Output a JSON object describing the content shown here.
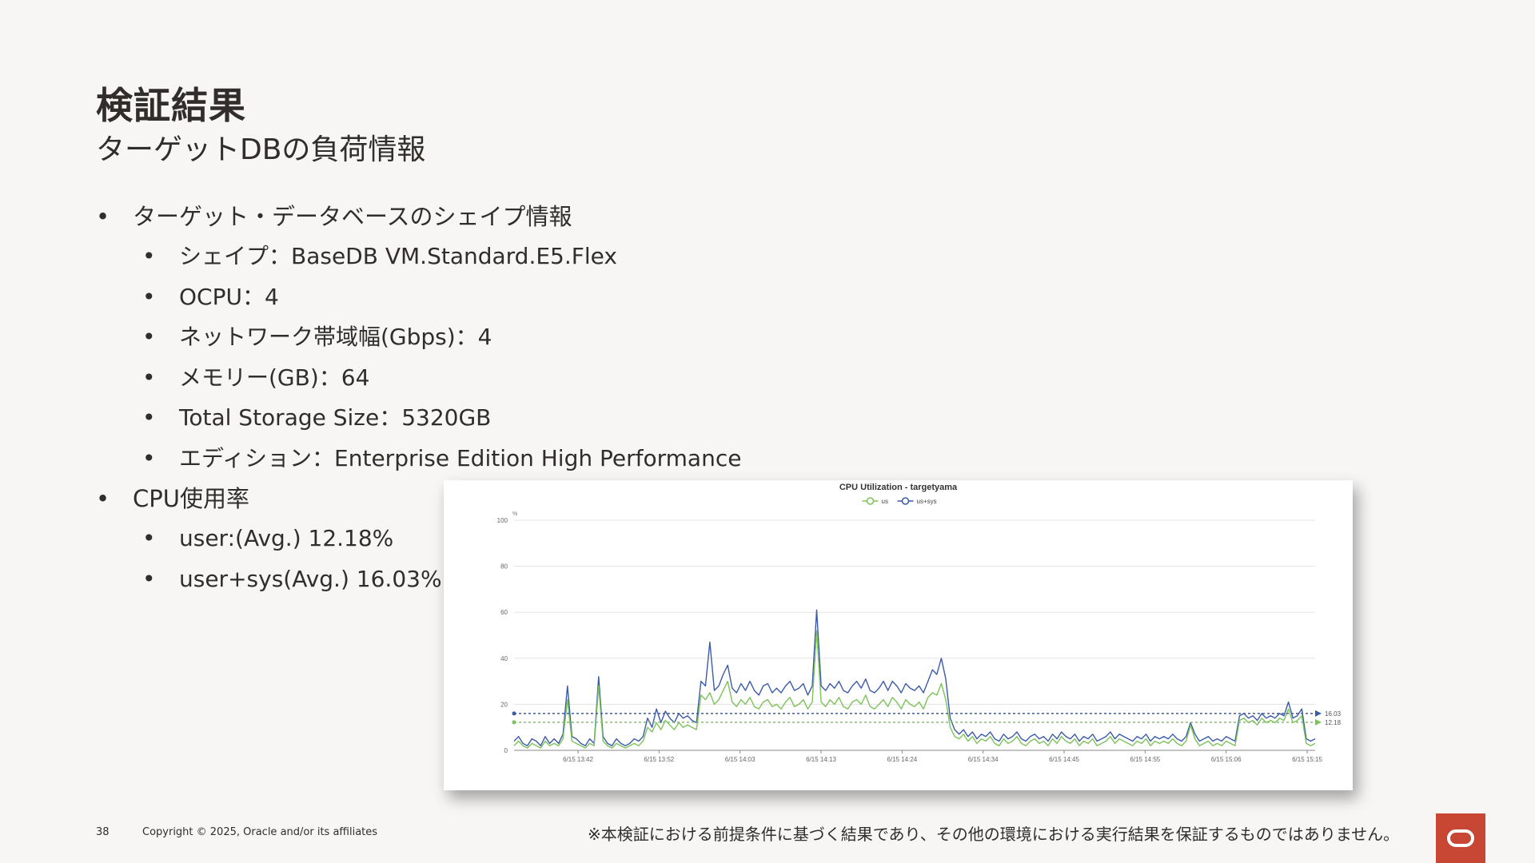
{
  "slide": {
    "title": "検証結果",
    "subtitle": "ターゲットDBの負荷情報",
    "bullets": {
      "shape_heading": "ターゲット・データベースのシェイプ情報",
      "shape": "シェイプ：BaseDB VM.Standard.E5.Flex",
      "ocpu": "OCPU：4",
      "network": "ネットワーク帯域幅(Gbps)：4",
      "memory": "メモリー(GB)：64",
      "storage": "Total Storage Size：5320GB",
      "edition": "エディション：Enterprise Edition High Performance",
      "cpu_heading": "CPU使用率",
      "user_avg": "user:(Avg.) 12.18%",
      "usersys_avg": "user+sys(Avg.) 16.03%"
    },
    "footer": {
      "page_number": "38",
      "copyright": "Copyright © 2025, Oracle and/or its affiliates",
      "note": "※本検証における前提条件に基づく結果であり、その他の環境における実行結果を保証するものではありません。"
    }
  },
  "colors": {
    "accent_red": "#c74634",
    "series_us": "#7cc35a",
    "series_ussys": "#3b5aa8"
  },
  "chart_data": {
    "type": "line",
    "title": "CPU Utilization - targetyama",
    "ylabel": "%",
    "ylim": [
      0,
      100
    ],
    "yticks": [
      0,
      20,
      40,
      60,
      80,
      100
    ],
    "xtick_labels": [
      "6/15 13:42",
      "6/15 13:52",
      "6/15 14:03",
      "6/15 14:13",
      "6/15 14:24",
      "6/15 14:34",
      "6/15 14:45",
      "6/15 14:55",
      "6/15 15:06",
      "6/15 15:15"
    ],
    "grid": true,
    "legend_position": "top-center",
    "avg_labels": [
      "16.03",
      "12.18"
    ],
    "series": [
      {
        "name": "us",
        "avg": 12.18,
        "values": [
          2,
          4,
          2,
          1,
          3,
          2,
          1,
          4,
          2,
          3,
          2,
          5,
          22,
          4,
          3,
          2,
          1,
          3,
          2,
          28,
          4,
          2,
          1,
          3,
          2,
          1,
          2,
          3,
          2,
          4,
          10,
          8,
          12,
          9,
          13,
          11,
          9,
          12,
          10,
          11,
          10,
          9,
          24,
          22,
          25,
          20,
          22,
          26,
          30,
          21,
          19,
          22,
          20,
          23,
          19,
          18,
          21,
          22,
          19,
          20,
          18,
          21,
          23,
          19,
          20,
          22,
          18,
          21,
          52,
          21,
          19,
          22,
          20,
          23,
          19,
          18,
          21,
          22,
          20,
          24,
          19,
          18,
          20,
          22,
          19,
          23,
          21,
          18,
          22,
          20,
          19,
          21,
          18,
          23,
          25,
          24,
          29,
          22,
          10,
          6,
          5,
          7,
          4,
          6,
          3,
          5,
          4,
          6,
          3,
          2,
          5,
          3,
          4,
          6,
          3,
          2,
          4,
          5,
          3,
          4,
          2,
          5,
          3,
          6,
          4,
          3,
          5,
          2,
          4,
          3,
          5,
          2,
          3,
          4,
          6,
          3,
          5,
          4,
          3,
          2,
          4,
          3,
          5,
          2,
          4,
          3,
          4,
          3,
          5,
          3,
          2,
          4,
          11,
          5,
          2,
          3,
          4,
          2,
          3,
          2,
          4,
          3,
          2,
          13,
          14,
          12,
          13,
          11,
          14,
          12,
          13,
          12,
          14,
          13,
          18,
          12,
          13,
          15,
          3,
          2,
          3
        ]
      },
      {
        "name": "us+sys",
        "values": [
          4,
          6,
          3,
          2,
          5,
          4,
          2,
          6,
          3,
          5,
          3,
          7,
          28,
          6,
          5,
          3,
          2,
          5,
          3,
          32,
          6,
          3,
          2,
          5,
          3,
          2,
          3,
          5,
          4,
          6,
          14,
          10,
          18,
          12,
          17,
          14,
          12,
          16,
          14,
          15,
          13,
          12,
          30,
          28,
          47,
          26,
          28,
          33,
          37,
          27,
          25,
          29,
          26,
          30,
          26,
          24,
          28,
          29,
          25,
          27,
          25,
          28,
          30,
          26,
          27,
          29,
          24,
          28,
          61,
          28,
          26,
          29,
          27,
          30,
          26,
          25,
          28,
          30,
          27,
          31,
          26,
          25,
          27,
          30,
          26,
          30,
          28,
          25,
          29,
          27,
          26,
          28,
          25,
          30,
          35,
          33,
          40,
          31,
          14,
          9,
          7,
          9,
          6,
          8,
          5,
          7,
          6,
          8,
          5,
          4,
          7,
          5,
          6,
          8,
          5,
          4,
          6,
          7,
          5,
          6,
          4,
          7,
          5,
          8,
          6,
          5,
          7,
          4,
          6,
          5,
          7,
          4,
          5,
          6,
          8,
          5,
          7,
          6,
          5,
          4,
          6,
          5,
          7,
          4,
          6,
          5,
          6,
          5,
          7,
          5,
          4,
          6,
          12,
          7,
          4,
          5,
          6,
          4,
          5,
          4,
          6,
          5,
          4,
          15,
          16,
          14,
          15,
          13,
          16,
          14,
          15,
          14,
          16,
          15,
          21,
          14,
          15,
          18,
          5,
          4,
          5
        ]
      }
    ]
  }
}
